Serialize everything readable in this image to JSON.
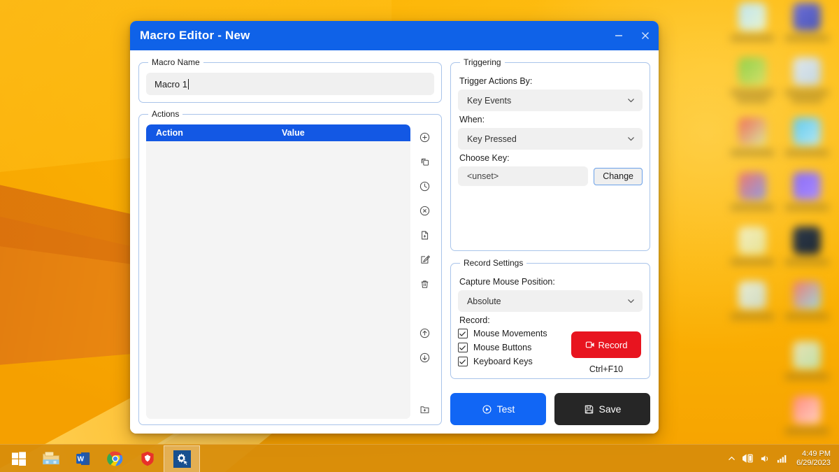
{
  "window": {
    "title": "Macro Editor - New",
    "titlebar_color": "#0f62e8",
    "controls": [
      {
        "name": "minimize",
        "glyph": "minimize-icon"
      },
      {
        "name": "close",
        "glyph": "close-icon"
      }
    ]
  },
  "macro_name": {
    "legend": "Macro Name",
    "value": "Macro 1",
    "has_caret": true
  },
  "actions": {
    "legend": "Actions",
    "columns": [
      "Action",
      "Value"
    ],
    "rows": [],
    "header_color": "#1358e4",
    "tools": [
      {
        "name": "add-action-icon",
        "title": "Add"
      },
      {
        "name": "duplicate-action-icon",
        "title": "Duplicate"
      },
      {
        "name": "delay-clock-icon",
        "title": "Delay"
      },
      {
        "name": "remove-action-icon",
        "title": "Remove"
      },
      {
        "name": "new-file-icon",
        "title": "New"
      },
      {
        "name": "edit-action-icon",
        "title": "Edit"
      },
      {
        "name": "delete-action-icon",
        "title": "Delete"
      },
      {
        "name": "move-up-icon",
        "title": "Move up"
      },
      {
        "name": "move-down-icon",
        "title": "Move down"
      },
      {
        "name": "open-folder-icon",
        "title": "Open"
      }
    ]
  },
  "triggering": {
    "legend": "Triggering",
    "trigger_by_label": "Trigger Actions By:",
    "trigger_by_value": "Key Events",
    "when_label": "When:",
    "when_value": "Key Pressed",
    "choose_key_label": "Choose Key:",
    "key_value": "<unset>",
    "change_label": "Change"
  },
  "record_settings": {
    "legend": "Record Settings",
    "capture_label": "Capture Mouse Position:",
    "capture_value": "Absolute",
    "record_label": "Record:",
    "checkboxes": [
      {
        "label": "Mouse Movements",
        "checked": true
      },
      {
        "label": "Mouse Buttons",
        "checked": true
      },
      {
        "label": "Keyboard Keys",
        "checked": true
      }
    ],
    "record_button": "Record",
    "record_button_color": "#e8141f",
    "hotkey": "Ctrl+F10"
  },
  "footer": {
    "test_label": "Test",
    "test_color": "#1166f5",
    "save_label": "Save",
    "save_color": "#262626"
  },
  "taskbar": {
    "items": [
      {
        "name": "start-button",
        "icon": "windows-logo-icon"
      },
      {
        "name": "file-explorer-button",
        "icon": "folder-icon"
      },
      {
        "name": "word-button",
        "icon": "word-icon"
      },
      {
        "name": "chrome-button",
        "icon": "chrome-icon"
      },
      {
        "name": "brave-button",
        "icon": "brave-lion-icon"
      },
      {
        "name": "macro-app-button",
        "icon": "gear-cursor-icon",
        "active": true
      }
    ],
    "tray": [
      {
        "name": "show-hidden-icons",
        "icon": "chevron-up-icon"
      },
      {
        "name": "network-icon",
        "icon": "network-icon"
      },
      {
        "name": "volume-icon",
        "icon": "speaker-icon"
      },
      {
        "name": "signal-icon",
        "icon": "signal-bars-icon"
      }
    ],
    "time": "4:49 PM",
    "date": "6/29/2023"
  },
  "desktop": {
    "wallpaper": "orange abstract ribbons",
    "icons_blurred": true,
    "icon_count": 14
  }
}
